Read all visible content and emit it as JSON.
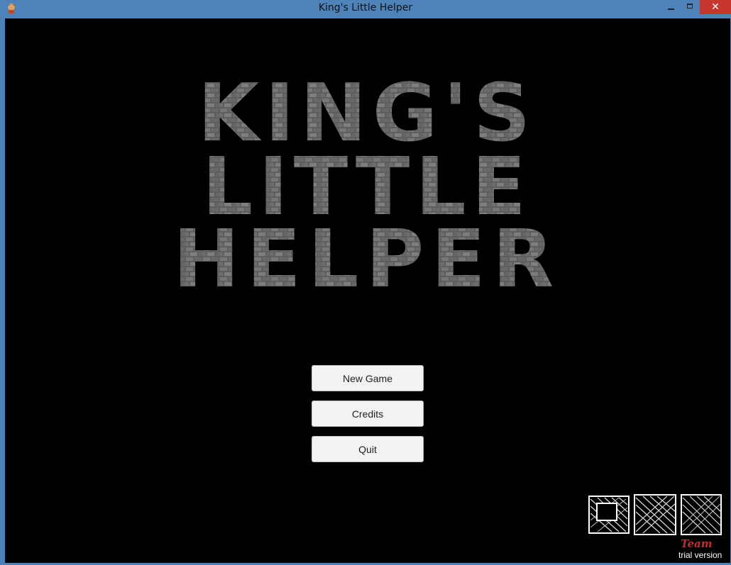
{
  "window": {
    "title": "King's Little Helper",
    "minimize_glyph": "",
    "maximize_glyph": "",
    "close_glyph": "✕"
  },
  "game_logo": {
    "line1": "KING'S",
    "line2": "LITTLE",
    "line3": "HELPER",
    "texture": "stone-wall",
    "color": "#6b6b6b"
  },
  "menu": {
    "new_game": "New Game",
    "credits": "Credits",
    "quit": "Quit"
  },
  "studio": {
    "team_label": "Team",
    "trial_label": "trial version",
    "team_color": "#c0312b"
  },
  "icons": {
    "app": "app-character-icon"
  }
}
